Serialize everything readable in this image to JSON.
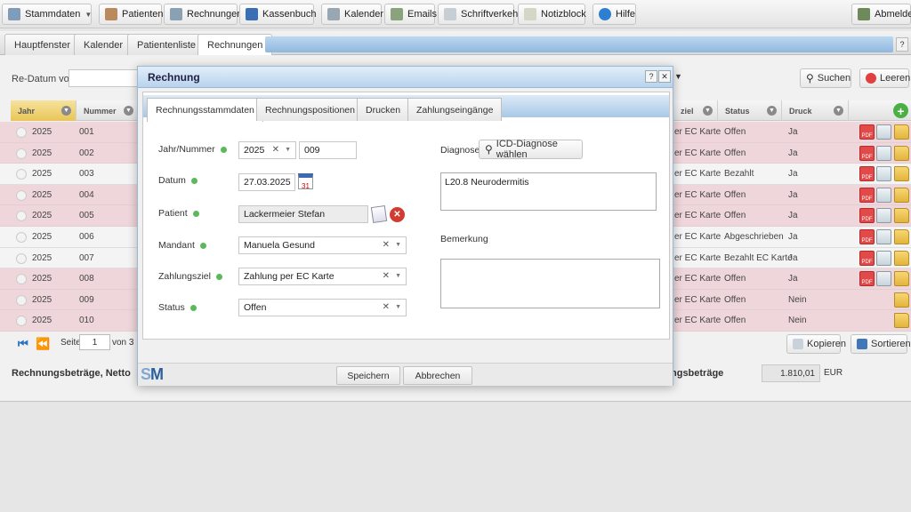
{
  "toolbar": {
    "stammdaten": "Stammdaten",
    "patienten": "Patienten",
    "rechnungen": "Rechnungen",
    "kassenbuch": "Kassenbuch",
    "kalender": "Kalender",
    "emails": "Emails",
    "schriftverkehr": "Schriftverkehr",
    "notizblock": "Notizblock",
    "hilfe": "Hilfe",
    "abmelden": "Abmelden"
  },
  "window_tabs": [
    "Hauptfenster",
    "Kalender",
    "Patientenliste",
    "Rechnungen"
  ],
  "filter": {
    "label": "Re-Datum von",
    "search_label": "Suchen",
    "clear_label": "Leeren"
  },
  "grid": {
    "headers": {
      "jahr": "Jahr",
      "nummer": "Nummer",
      "zahlungsziel": "ziel",
      "status": "Status",
      "druck": "Druck"
    },
    "rows": [
      {
        "jahr": "2025",
        "nummer": "001",
        "ziel": "er EC Karte",
        "status": "Offen",
        "druck": "Ja",
        "state": "open",
        "icons": true
      },
      {
        "jahr": "2025",
        "nummer": "002",
        "ziel": "er EC Karte",
        "status": "Offen",
        "druck": "Ja",
        "state": "open",
        "icons": true
      },
      {
        "jahr": "2025",
        "nummer": "003",
        "ziel": "er EC Karte",
        "status": "Bezahlt",
        "druck": "Ja",
        "state": "plain",
        "icons": true
      },
      {
        "jahr": "2025",
        "nummer": "004",
        "ziel": "er EC Karte",
        "status": "Offen",
        "druck": "Ja",
        "state": "open",
        "icons": true
      },
      {
        "jahr": "2025",
        "nummer": "005",
        "ziel": "er EC Karte",
        "status": "Offen",
        "druck": "Ja",
        "state": "open",
        "icons": true
      },
      {
        "jahr": "2025",
        "nummer": "006",
        "ziel": "er EC Karte",
        "status": "Abgeschrieben",
        "druck": "Ja",
        "state": "plain",
        "icons": true
      },
      {
        "jahr": "2025",
        "nummer": "007",
        "ziel": "er EC Karte",
        "status": "Bezahlt EC Karte",
        "druck": "Ja",
        "state": "plain",
        "icons": true
      },
      {
        "jahr": "2025",
        "nummer": "008",
        "ziel": "er EC Karte",
        "status": "Offen",
        "druck": "Ja",
        "state": "open",
        "icons": true
      },
      {
        "jahr": "2025",
        "nummer": "009",
        "ziel": "er EC Karte",
        "status": "Offen",
        "druck": "Nein",
        "state": "open",
        "icons": false
      },
      {
        "jahr": "2025",
        "nummer": "010",
        "ziel": "er EC Karte",
        "status": "Offen",
        "druck": "Nein",
        "state": "open",
        "icons": false
      }
    ]
  },
  "pager": {
    "seite_label": "Seite",
    "page": "1",
    "von": "von 3",
    "kopieren": "Kopieren",
    "sortieren": "Sortieren"
  },
  "footer": {
    "left_label": "Rechnungsbeträge, Netto",
    "right_label": "ngsbeträge",
    "sum": "1.810,01",
    "currency": "EUR"
  },
  "modal": {
    "title": "Rechnung",
    "help": "?",
    "close": "✕",
    "tabs": [
      "Rechnungsstammdaten",
      "Rechnungspositionen",
      "Drucken",
      "Zahlungseingänge"
    ],
    "fields": {
      "jahr_nummer_label": "Jahr/Nummer",
      "jahr": "2025",
      "nummer": "009",
      "datum_label": "Datum",
      "datum": "27.03.2025",
      "patient_label": "Patient",
      "patient": "Lackermeier Stefan",
      "mandant_label": "Mandant",
      "mandant": "Manuela Gesund",
      "zahlungsziel_label": "Zahlungsziel",
      "zahlungsziel": "Zahlung per EC Karte",
      "status_label": "Status",
      "status": "Offen",
      "diagnose_label": "Diagnose",
      "icd_button": "ICD-Diagnose wählen",
      "diagnose": "L20.8 Neurodermitis",
      "bemerkung_label": "Bemerkung",
      "bemerkung": ""
    },
    "save": "Speichern",
    "cancel": "Abbrechen",
    "logo_s": "S",
    "logo_m": "M"
  },
  "colors": {
    "accent": "#2a74c4",
    "open_row": "#efd6da",
    "status_dot": "#5cb85c"
  }
}
